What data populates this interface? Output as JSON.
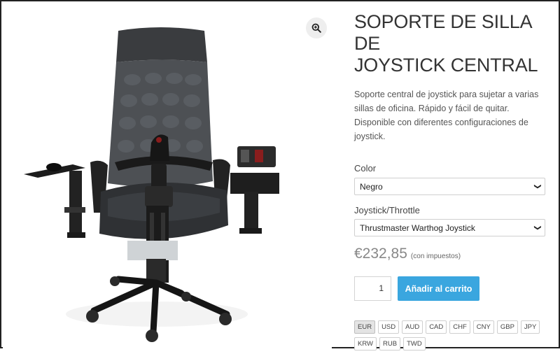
{
  "product": {
    "title_line1": "SOPORTE DE SILLA DE",
    "title_line2": "JOYSTICK CENTRAL",
    "description": "Soporte central de joystick para sujetar a varias sillas de oficina. Rápido y fácil de quitar. Disponible con diferentes configuraciones de joystick.",
    "image_alt": "office chair with central joystick mount",
    "zoom_icon": "magnifier-plus-icon"
  },
  "options": {
    "color_label": "Color",
    "color_value": "Negro",
    "joystick_label": "Joystick/Throttle",
    "joystick_value": "Thrustmaster Warthog Joystick"
  },
  "price": {
    "amount": "€232,85",
    "tax_note": "(con impuestos)"
  },
  "cart": {
    "quantity": "1",
    "add_label": "Añadir al carrito",
    "button_color": "#3aa6df"
  },
  "currencies": {
    "active": "EUR",
    "items": [
      "EUR",
      "USD",
      "AUD",
      "CAD",
      "CHF",
      "CNY",
      "GBP",
      "JPY",
      "KRW",
      "RUB",
      "TWD"
    ]
  }
}
